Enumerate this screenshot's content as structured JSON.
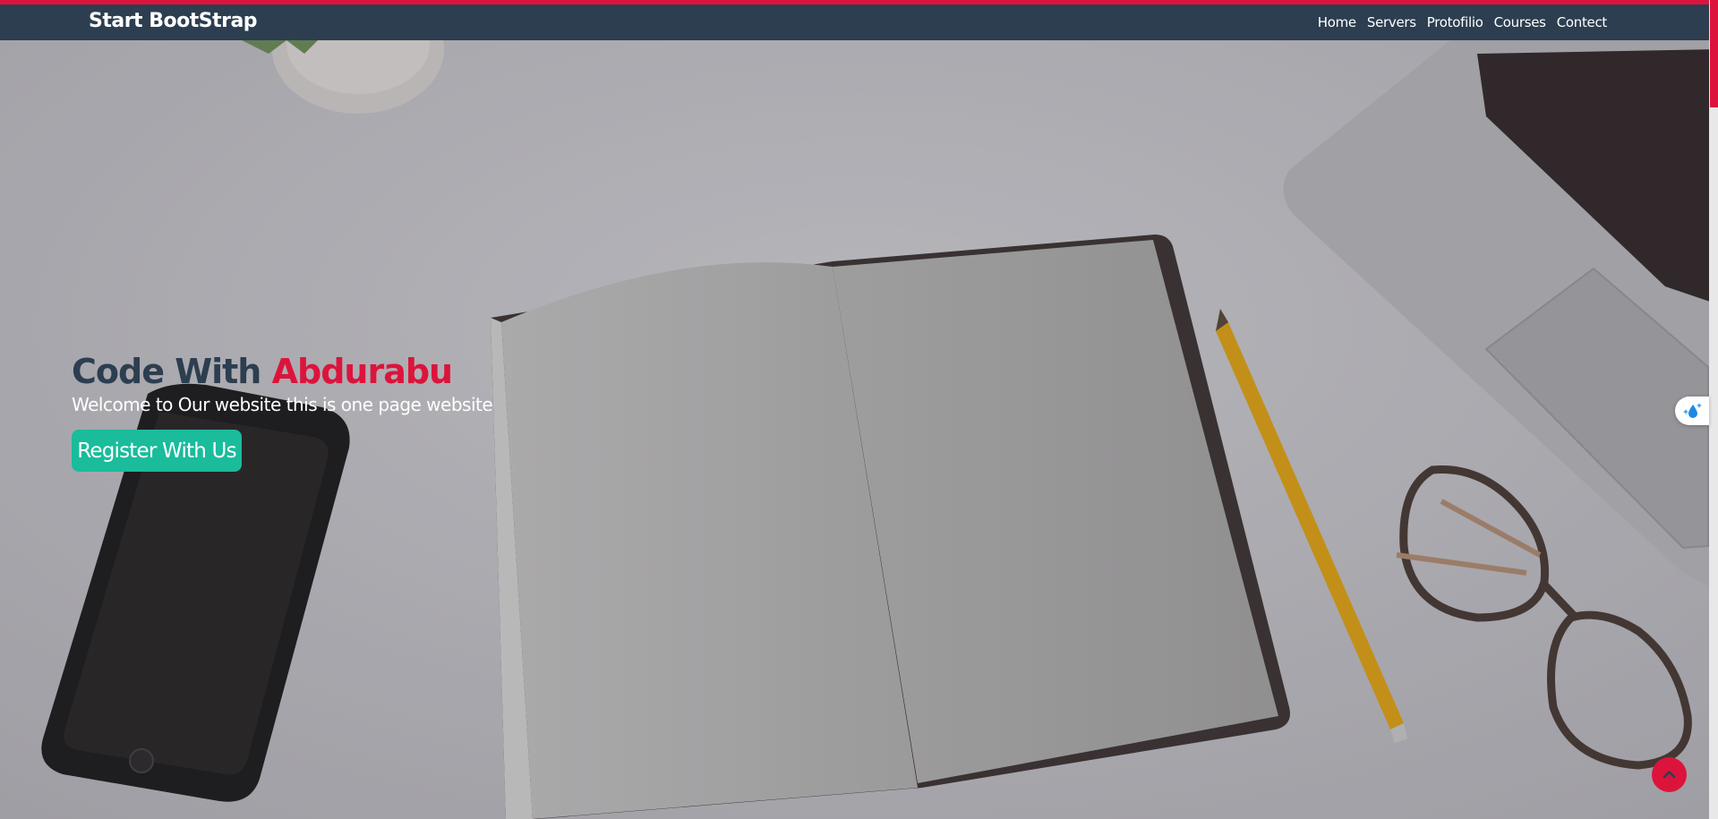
{
  "navbar": {
    "brand": "Start BootStrap",
    "links": [
      "Home",
      "Servers",
      "Protofilio",
      "Courses",
      "Contect"
    ]
  },
  "hero": {
    "title_prefix": "Code With ",
    "title_accent": "Abdurabu",
    "subtitle": "Welcome to Our website this is one page website",
    "cta_label": "Register With Us"
  },
  "colors": {
    "navbar": "#2c3e50",
    "accent": "#dc143c",
    "button": "#1abc9c",
    "title": "#2c3e50"
  },
  "icons": {
    "side_widget": "water-drop-sparkle-icon",
    "back_to_top": "chevron-up-icon"
  }
}
